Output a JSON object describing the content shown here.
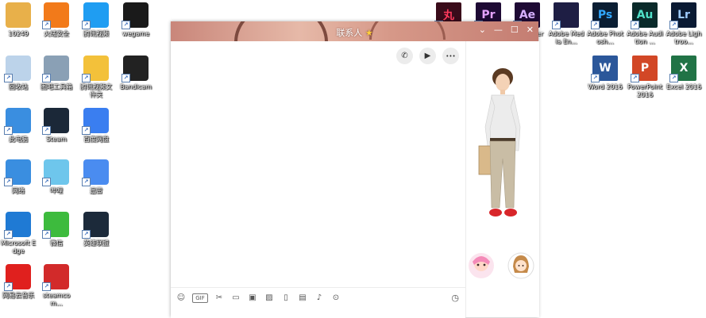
{
  "desktop": {
    "left_icons": [
      {
        "label": "10249",
        "icon": "user-folder-icon",
        "color": "#e8b04a"
      },
      {
        "label": "火绒安全",
        "icon": "huorong-icon",
        "color": "#f27a1a"
      },
      {
        "label": "腾讯视频",
        "icon": "tencent-video-icon",
        "color": "#1f9df2"
      },
      {
        "label": "wegame",
        "icon": "wegame-icon",
        "color": "#1a1a1a"
      },
      {
        "label": "回收站",
        "icon": "recycle-bin-icon",
        "color": "#bcd3ea"
      },
      {
        "label": "图吧工具箱",
        "icon": "toolbox-icon",
        "color": "#8aa0b5"
      },
      {
        "label": "腾讯视频文件夹",
        "icon": "folder-icon",
        "color": "#f3c13a"
      },
      {
        "label": "Bandicam",
        "icon": "bandicam-icon",
        "color": "#222222"
      },
      {
        "label": "此电脑",
        "icon": "computer-icon",
        "color": "#3a8ee0"
      },
      {
        "label": "Steam",
        "icon": "steam-icon",
        "color": "#1b2838"
      },
      {
        "label": "百度网盘",
        "icon": "baidu-netdisk-icon",
        "color": "#3a7ef0"
      },
      {
        "label": "网络",
        "icon": "network-icon",
        "color": "#3a8ee0"
      },
      {
        "label": "哔哩",
        "icon": "bilibili-icon",
        "color": "#6ec6ec"
      },
      {
        "label": "迅雷",
        "icon": "xunlei-icon",
        "color": "#4a8cf0"
      },
      {
        "label": "Microsoft Edge",
        "icon": "edge-icon",
        "color": "#1f7ad4"
      },
      {
        "label": "微信",
        "icon": "wechat-icon",
        "color": "#3dbb3d"
      },
      {
        "label": "英雄联盟",
        "icon": "lol-icon",
        "color": "#1c2a3a"
      },
      {
        "label": "网易云音乐",
        "icon": "netease-music-icon",
        "color": "#e0201e"
      },
      {
        "label": "steamcom...",
        "icon": "steamcommunity-icon",
        "color": "#d22a2a"
      }
    ],
    "right_icons": [
      {
        "label": "",
        "icon": "maruyama-icon",
        "text": "丸",
        "color": "#3a0b1a",
        "fg": "#ff3a5c"
      },
      {
        "label": "",
        "icon": "premiere-icon",
        "text": "Pr",
        "color": "#1e0a34",
        "fg": "#e6a3ff"
      },
      {
        "label": "",
        "icon": "after-effects-icon",
        "text": "Ae",
        "color": "#1e0a34",
        "fg": "#d6b0ff"
      },
      {
        "label": "Adobe Media En...",
        "icon": "media-encoder-icon",
        "text": "",
        "color": "#1e1e44",
        "fg": "#a3a3ff"
      },
      {
        "label": "Adobe Photosh...",
        "icon": "photoshop-icon",
        "text": "Ps",
        "color": "#0b1e33",
        "fg": "#31a8ff"
      },
      {
        "label": "Adobe Audition ...",
        "icon": "audition-icon",
        "text": "Au",
        "color": "#0a2a2a",
        "fg": "#4fe0c8"
      },
      {
        "label": "Adobe Lightroo...",
        "icon": "lightroom-icon",
        "text": "Lr",
        "color": "#0a1a33",
        "fg": "#9ecbff"
      },
      {
        "label": "Word 2016",
        "icon": "word-icon",
        "text": "W",
        "color": "#2b579a",
        "fg": "#ffffff"
      },
      {
        "label": "PowerPoint 2016",
        "icon": "powerpoint-icon",
        "text": "P",
        "color": "#d24726",
        "fg": "#ffffff"
      },
      {
        "label": "Excel 2016",
        "icon": "excel-icon",
        "text": "X",
        "color": "#217346",
        "fg": "#ffffff"
      }
    ],
    "partial_label": "er"
  },
  "chat_window": {
    "title": "联系人",
    "title_star": "★",
    "controls": {
      "min": "—",
      "max": "☐",
      "close": "✕",
      "dropdown": "⌄"
    },
    "call_buttons": [
      {
        "name": "voice-call-icon",
        "glyph": "✆"
      },
      {
        "name": "video-call-icon",
        "glyph": "▶"
      },
      {
        "name": "more-icon",
        "glyph": "•••"
      }
    ],
    "tools": [
      {
        "name": "emoji-icon",
        "glyph": "☺"
      },
      {
        "name": "gif-icon",
        "glyph": "GIF"
      },
      {
        "name": "screenshot-icon",
        "glyph": "✂"
      },
      {
        "name": "file-icon",
        "glyph": "▭"
      },
      {
        "name": "sticker-icon",
        "glyph": "▣"
      },
      {
        "name": "image-icon",
        "glyph": "▨"
      },
      {
        "name": "shake-icon",
        "glyph": "▯"
      },
      {
        "name": "red-packet-icon",
        "glyph": "▤"
      },
      {
        "name": "music-icon",
        "glyph": "♪"
      },
      {
        "name": "more-tools-icon",
        "glyph": "⊙"
      }
    ],
    "history_glyph": "◷"
  },
  "colors": {
    "accent": "#c47d72"
  }
}
